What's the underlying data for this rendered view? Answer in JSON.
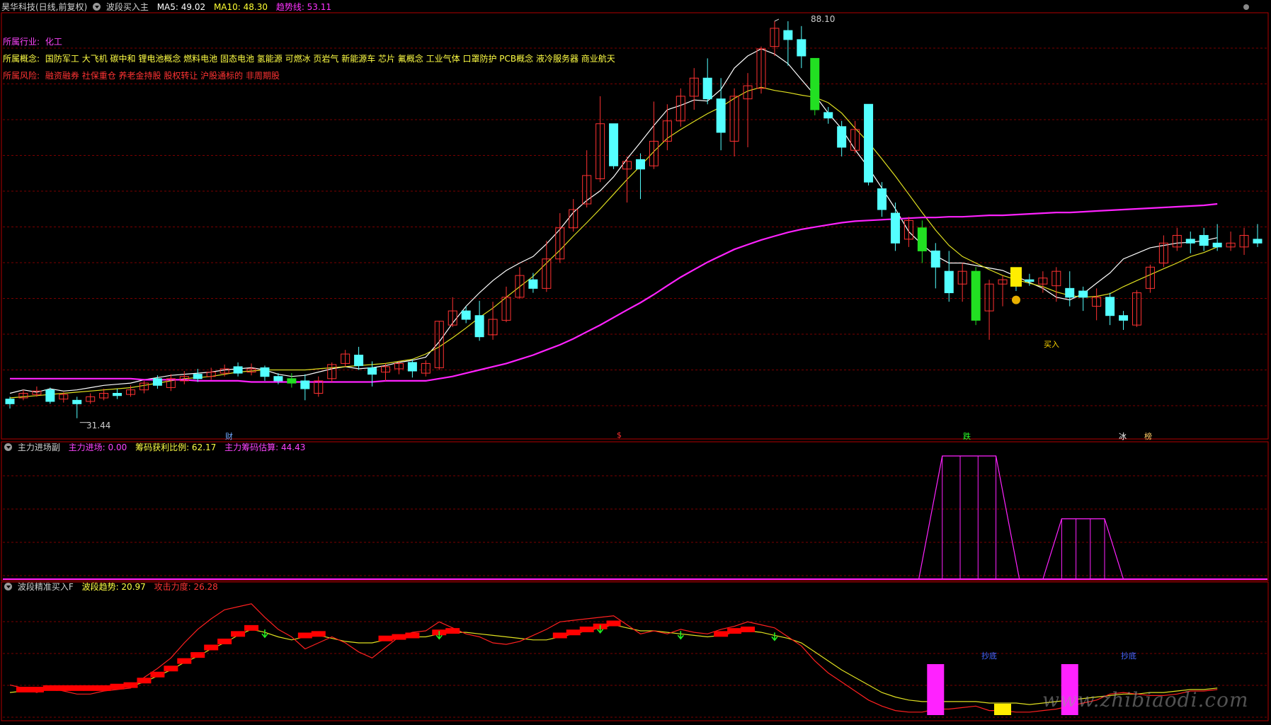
{
  "stock": {
    "name_line": "昊华科技(日线,前复权)",
    "indicator": "波段买入主"
  },
  "main_header": {
    "ma5": "MA5: 49.02",
    "ma10": "MA10: 48.30",
    "trend": "趋势线: 53.11"
  },
  "info": {
    "industry_label": "所属行业:",
    "industry_value": "化工",
    "concept_label": "所属概念:",
    "concept_value": "国防军工 大飞机 碳中和 锂电池概念 燃料电池 固态电池 氢能源 可燃冰 页岩气 新能源车 芯片 氟概念 工业气体 口罩防护 PCB概念 液冷服务器 商业航天",
    "risk_label": "所属风险:",
    "risk_value": "融资融券 社保重仓 养老金持股 股权转让 沪股通标的 非周期股"
  },
  "price_labels": {
    "high": "88.10",
    "low": "31.44"
  },
  "events": [
    {
      "label": "财",
      "color": "#6fa8ff"
    },
    {
      "label": "$",
      "color": "#ff3030"
    },
    {
      "label": "跌",
      "color": "#2aff2a"
    },
    {
      "label": "冰",
      "color": "#ffffff"
    },
    {
      "label": "榜",
      "color": "#ffcc66"
    }
  ],
  "buy_marker": "买入",
  "panel2": {
    "name": "主力进场副",
    "v1": "主力进场: 0.00",
    "v2": "筹码获利比例: 62.17",
    "v3": "主力筹码估算: 44.43"
  },
  "panel3": {
    "name": "波段精准买入F",
    "v1": "波段趋势: 20.97",
    "v2": "攻击力度: 26.28",
    "bottom_label": "抄底"
  },
  "watermark": "www.zhibiaodi.com",
  "colors": {
    "up": "#ff3232",
    "down": "#54ffff",
    "down_big": "#22e022",
    "ma5": "#ffffff",
    "ma10": "#e0e020",
    "trend": "#ff22ff",
    "grid": "#7a0000",
    "axis_border": "#b00000"
  },
  "chart_data": [
    {
      "type": "candlestick",
      "title": "波段买入主",
      "series": [
        {
          "name": "MA5",
          "values": [
            33.5,
            33.8,
            33.6,
            33.9,
            33.7,
            33.8,
            34.0,
            34.2,
            34.3,
            34.4,
            34.7,
            34.9,
            35.1,
            35.2,
            35.3,
            35.4,
            35.6,
            35.7,
            35.8,
            35.6,
            35.2,
            35.0,
            35.1,
            35.4,
            35.7,
            35.9,
            35.7,
            35.8,
            36.0,
            36.3,
            36.5,
            36.8,
            38.3,
            40.2,
            42.0,
            43.5,
            44.9,
            46.1,
            47.0,
            47.8,
            49.4,
            51.3,
            53.6,
            55.3,
            56.7,
            58.8,
            61.6,
            64.3,
            67.2,
            70.0,
            70.8,
            71.8,
            71.6,
            73.8,
            78.0,
            80.5,
            82.0,
            80.9,
            78.9,
            75.7,
            72.7,
            69.4,
            66.6,
            63.1,
            60.2,
            57.1,
            54.1,
            51.0,
            49.3,
            47.9,
            47.0,
            47.0,
            46.7,
            46.4,
            46.1,
            45.4,
            44.7,
            44.0,
            43.0,
            42.7,
            43.4,
            44.6,
            45.8,
            47.5,
            48.2,
            48.9,
            49.2,
            49.5,
            49.6,
            49.8,
            50.2
          ]
        },
        {
          "name": "MA10",
          "values": [
            33.1,
            33.2,
            33.3,
            33.4,
            33.5,
            33.6,
            33.7,
            33.8,
            33.9,
            34.0,
            34.2,
            34.4,
            34.6,
            34.8,
            34.9,
            35.0,
            35.2,
            35.4,
            35.5,
            35.6,
            35.6,
            35.6,
            35.6,
            35.7,
            35.8,
            35.9,
            36.0,
            36.1,
            36.2,
            36.4,
            36.6,
            37.1,
            37.8,
            38.7,
            39.7,
            40.8,
            41.8,
            43.0,
            44.2,
            45.4,
            47.0,
            48.6,
            50.4,
            52.2,
            54.1,
            56.2,
            58.4,
            60.5,
            62.8,
            65.0,
            66.5,
            67.9,
            69.3,
            70.5,
            72.1,
            73.5,
            74.2,
            73.6,
            73.2,
            72.7,
            72.3,
            71.3,
            69.4,
            66.7,
            64.3,
            61.6,
            58.9,
            56.2,
            53.6,
            51.2,
            49.2,
            47.8,
            47.0,
            46.2,
            45.5,
            45.0,
            44.6,
            44.2,
            43.6,
            43.2,
            43.0,
            43.1,
            43.4,
            44.2,
            44.9,
            45.6,
            46.3,
            47.0,
            47.8,
            48.3,
            49.0
          ]
        },
        {
          "name": "趋势线",
          "values": [
            34.8,
            34.8,
            34.8,
            34.8,
            34.8,
            34.8,
            34.8,
            34.8,
            34.8,
            34.8,
            34.7,
            34.7,
            34.7,
            34.7,
            34.6,
            34.6,
            34.6,
            34.6,
            34.5,
            34.5,
            34.5,
            34.5,
            34.5,
            34.5,
            34.5,
            34.5,
            34.5,
            34.5,
            34.6,
            34.6,
            34.6,
            34.6,
            34.8,
            35.0,
            35.3,
            35.6,
            35.9,
            36.2,
            36.6,
            37.0,
            37.5,
            38.0,
            38.6,
            39.3,
            40.0,
            40.8,
            41.6,
            42.4,
            43.3,
            44.3,
            45.3,
            46.2,
            47.1,
            47.9,
            48.7,
            49.3,
            49.9,
            50.4,
            50.9,
            51.3,
            51.6,
            51.9,
            52.2,
            52.4,
            52.5,
            52.6,
            52.7,
            52.8,
            52.9,
            52.9,
            53.0,
            53.0,
            53.1,
            53.2,
            53.2,
            53.3,
            53.4,
            53.5,
            53.6,
            53.6,
            53.7,
            53.8,
            53.9,
            54.0,
            54.1,
            54.2,
            54.3,
            54.4,
            54.5,
            54.6,
            54.8
          ]
        }
      ],
      "ohlc": [
        [
          33.0,
          32.6,
          33.2,
          32.2
        ],
        [
          33.1,
          33.5,
          33.8,
          32.9
        ],
        [
          33.4,
          33.7,
          34.1,
          33.2
        ],
        [
          33.8,
          32.8,
          34.0,
          32.6
        ],
        [
          33.0,
          33.4,
          33.6,
          32.7
        ],
        [
          32.9,
          32.6,
          33.2,
          31.4
        ],
        [
          32.8,
          33.2,
          33.5,
          32.6
        ],
        [
          33.1,
          33.5,
          33.9,
          32.9
        ],
        [
          33.5,
          33.3,
          33.9,
          33.0
        ],
        [
          33.4,
          33.8,
          34.2,
          33.2
        ],
        [
          33.8,
          34.4,
          34.6,
          33.5
        ],
        [
          34.8,
          34.2,
          35.1,
          33.9
        ],
        [
          34.0,
          34.8,
          35.2,
          33.7
        ],
        [
          34.6,
          35.0,
          35.5,
          34.3
        ],
        [
          35.2,
          34.8,
          35.7,
          34.5
        ],
        [
          35.0,
          35.4,
          35.8,
          34.7
        ],
        [
          35.3,
          35.7,
          36.1,
          35.0
        ],
        [
          35.9,
          35.3,
          36.3,
          35.0
        ],
        [
          35.4,
          35.7,
          36.2,
          35.1
        ],
        [
          35.8,
          35.0,
          36.0,
          34.6
        ],
        [
          35.0,
          34.6,
          35.3,
          34.3
        ],
        [
          34.8,
          34.4,
          35.3,
          34.0
        ],
        [
          34.6,
          33.9,
          35.2,
          32.9
        ],
        [
          33.5,
          34.6,
          35.0,
          33.2
        ],
        [
          34.8,
          36.1,
          36.3,
          34.5
        ],
        [
          36.2,
          37.1,
          37.5,
          35.9
        ],
        [
          37.0,
          36.0,
          37.8,
          35.6
        ],
        [
          35.8,
          35.2,
          36.4,
          34.1
        ],
        [
          35.4,
          35.9,
          36.2,
          34.6
        ],
        [
          35.7,
          36.2,
          36.4,
          35.2
        ],
        [
          36.3,
          35.5,
          36.6,
          34.9
        ],
        [
          35.3,
          36.2,
          36.5,
          35.0
        ],
        [
          35.8,
          40.4,
          40.4,
          35.6
        ],
        [
          40.0,
          41.5,
          43.0,
          39.8
        ],
        [
          41.5,
          40.6,
          42.0,
          40.2
        ],
        [
          41.0,
          38.8,
          42.6,
          38.4
        ],
        [
          39.0,
          40.6,
          42.5,
          38.5
        ],
        [
          40.5,
          43.0,
          44.2,
          40.3
        ],
        [
          43.0,
          45.5,
          46.5,
          42.8
        ],
        [
          45.0,
          44.0,
          45.8,
          43.5
        ],
        [
          44.0,
          47.5,
          49.8,
          43.6
        ],
        [
          47.5,
          51.5,
          53.5,
          47.0
        ],
        [
          51.5,
          54.0,
          55.5,
          51.0
        ],
        [
          54.8,
          59.0,
          63.0,
          54.3
        ],
        [
          58.5,
          67.5,
          72.5,
          58.0
        ],
        [
          67.5,
          60.5,
          67.5,
          60.0
        ],
        [
          60.0,
          61.2,
          62.0,
          55.0
        ],
        [
          61.5,
          60.0,
          62.5,
          55.5
        ],
        [
          60.5,
          64.5,
          71.5,
          60.0
        ],
        [
          64.5,
          68.0,
          71.0,
          63.0
        ],
        [
          68.0,
          72.5,
          74.0,
          67.0
        ],
        [
          72.5,
          76.0,
          78.0,
          70.0
        ],
        [
          76.0,
          72.0,
          80.0,
          71.0
        ],
        [
          72.0,
          66.0,
          76.0,
          63.0
        ],
        [
          64.5,
          72.5,
          74.0,
          62.0
        ],
        [
          72.0,
          74.5,
          77.0,
          63.5
        ],
        [
          74.0,
          82.0,
          82.5,
          73.0
        ],
        [
          82.5,
          86.5,
          88.1,
          80.5
        ],
        [
          86.0,
          84.0,
          88.1,
          78.5
        ],
        [
          84.0,
          80.5,
          87.0,
          78.0
        ],
        [
          80.0,
          70.0,
          80.0,
          69.0
        ],
        [
          69.5,
          68.5,
          70.5,
          67.5
        ],
        [
          67.0,
          63.5,
          68.0,
          62.0
        ],
        [
          63.0,
          66.5,
          68.0,
          62.5
        ],
        [
          71.0,
          58.0,
          71.0,
          57.5
        ],
        [
          57.0,
          54.0,
          58.0,
          53.0
        ],
        [
          53.5,
          49.5,
          55.0,
          48.5
        ],
        [
          50.0,
          52.5,
          53.0,
          49.0
        ],
        [
          51.5,
          48.5,
          52.5,
          47.0
        ],
        [
          48.5,
          46.5,
          49.5,
          44.0
        ],
        [
          46.0,
          43.5,
          48.5,
          42.5
        ],
        [
          44.5,
          46.0,
          47.0,
          42.5
        ],
        [
          46.0,
          40.5,
          46.5,
          40.0
        ],
        [
          41.5,
          44.5,
          45.0,
          38.5
        ],
        [
          44.5,
          45.0,
          45.5,
          42.0
        ],
        [
          45.0,
          44.5,
          45.5,
          43.7
        ],
        [
          45.0,
          44.8,
          45.7,
          44.3
        ],
        [
          44.5,
          45.2,
          46.0,
          43.5
        ],
        [
          44.3,
          46.0,
          46.5,
          42.5
        ],
        [
          44.0,
          43.0,
          46.0,
          42.0
        ],
        [
          43.7,
          43.0,
          44.2,
          41.5
        ],
        [
          42.0,
          43.0,
          44.0,
          40.5
        ],
        [
          43.0,
          41.0,
          43.5,
          40.0
        ],
        [
          41.0,
          40.5,
          41.5,
          39.5
        ],
        [
          40.0,
          43.5,
          43.8,
          39.8
        ],
        [
          44.0,
          46.5,
          46.8,
          43.5
        ],
        [
          47.0,
          49.5,
          50.5,
          46.5
        ],
        [
          49.0,
          50.5,
          51.5,
          48.5
        ],
        [
          50.0,
          49.5,
          51.0,
          48.2
        ],
        [
          50.5,
          49.2,
          51.5,
          48.5
        ],
        [
          49.5,
          49.0,
          52.0,
          48.5
        ],
        [
          49.0,
          49.5,
          51.0,
          48.5
        ],
        [
          49.0,
          50.5,
          51.5,
          48.0
        ],
        [
          50.0,
          49.5,
          52.0,
          49.0
        ]
      ],
      "ylim": [
        30,
        90
      ],
      "x": "trading days (91 bars)"
    },
    {
      "type": "area",
      "title": "主力进场副",
      "series": [
        {
          "name": "主力进场",
          "peaks": [
            {
              "from_bar": 69,
              "to_bar": 74,
              "value": 100
            },
            {
              "from_bar": 78,
              "to_bar": 82,
              "value": 49
            }
          ]
        }
      ]
    },
    {
      "type": "line",
      "title": "波段精准买入F",
      "series": [
        {
          "name": "波段趋势",
          "values": [
            15,
            16,
            16,
            17,
            17,
            17,
            17,
            17,
            18,
            19,
            22,
            26,
            30,
            35,
            39,
            44,
            48,
            53,
            57,
            55,
            52,
            50,
            52,
            53,
            51,
            49,
            48,
            48,
            50,
            51,
            52,
            52,
            54,
            55,
            55,
            54,
            53,
            52,
            51,
            50,
            50,
            52,
            54,
            56,
            58,
            60,
            58,
            56,
            56,
            55,
            54,
            53,
            52,
            53,
            55,
            56,
            55,
            53,
            51,
            48,
            42,
            36,
            30,
            25,
            20,
            15,
            12,
            10,
            9,
            9,
            9,
            9,
            9,
            8,
            8,
            8,
            7,
            8,
            9,
            10,
            11,
            12,
            13,
            14,
            14,
            15,
            15,
            16,
            17,
            17,
            18
          ]
        },
        {
          "name": "攻击力度",
          "values": [
            20,
            18,
            15,
            18,
            16,
            14,
            14,
            16,
            17,
            18,
            25,
            31,
            38,
            48,
            57,
            64,
            70,
            72,
            74,
            65,
            57,
            52,
            44,
            48,
            52,
            48,
            42,
            38,
            45,
            52,
            55,
            56,
            62,
            58,
            54,
            52,
            48,
            47,
            49,
            53,
            57,
            62,
            63,
            64,
            65,
            66,
            60,
            54,
            56,
            54,
            57,
            55,
            54,
            57,
            59,
            62,
            60,
            58,
            52,
            46,
            36,
            28,
            22,
            16,
            10,
            6,
            3,
            2,
            2,
            4,
            4,
            5,
            6,
            3,
            3,
            2,
            2,
            3,
            4,
            6,
            8,
            10,
            14,
            15,
            14,
            13,
            13,
            14,
            16,
            16,
            17
          ]
        }
      ]
    }
  ]
}
